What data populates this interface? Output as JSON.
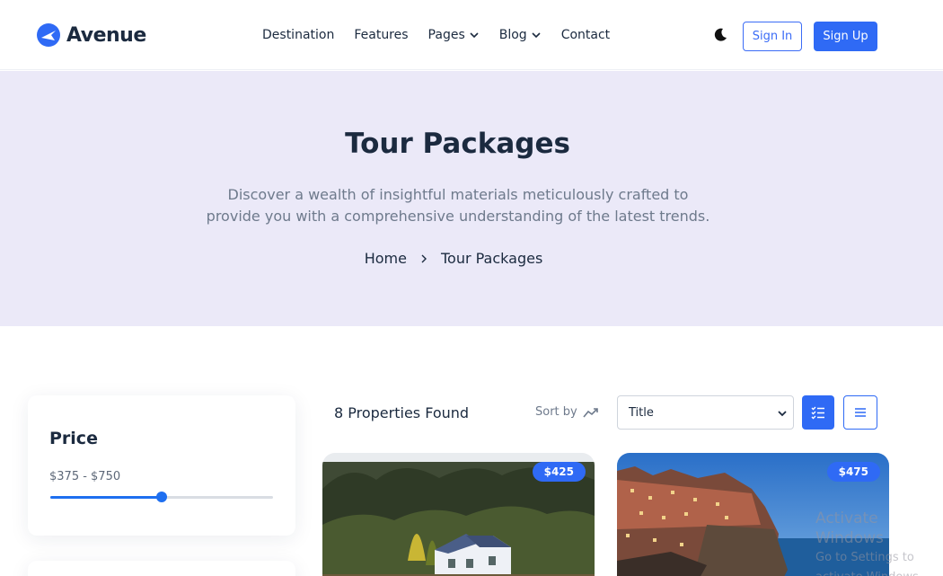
{
  "header": {
    "logo_text": "Avenue",
    "nav": [
      {
        "label": "Destination",
        "dropdown": false
      },
      {
        "label": "Features",
        "dropdown": false
      },
      {
        "label": "Pages",
        "dropdown": true
      },
      {
        "label": "Blog",
        "dropdown": true
      },
      {
        "label": "Contact",
        "dropdown": false
      }
    ],
    "sign_in": "Sign In",
    "sign_up": "Sign Up"
  },
  "hero": {
    "title": "Tour Packages",
    "description": "Discover a wealth of insightful materials meticulously crafted to provide you with a comprehensive understanding of the latest trends.",
    "breadcrumb": [
      "Home",
      "Tour Packages"
    ]
  },
  "filters": {
    "price": {
      "title": "Price",
      "range_text": "$375 - $750",
      "slider_fraction": 0.5
    }
  },
  "listing": {
    "found_text": "8 Properties Found",
    "sort_label": "Sort by",
    "sort_value": "Title",
    "cards": [
      {
        "price": "$425"
      },
      {
        "price": "$475"
      }
    ]
  },
  "watermark": {
    "line1": "Activate Windows",
    "line2": "Go to Settings to activate Windows."
  },
  "colors": {
    "accent": "#2f6af5",
    "hero_bg": "#ebe9f8",
    "text_dark": "#1b2a3f"
  }
}
